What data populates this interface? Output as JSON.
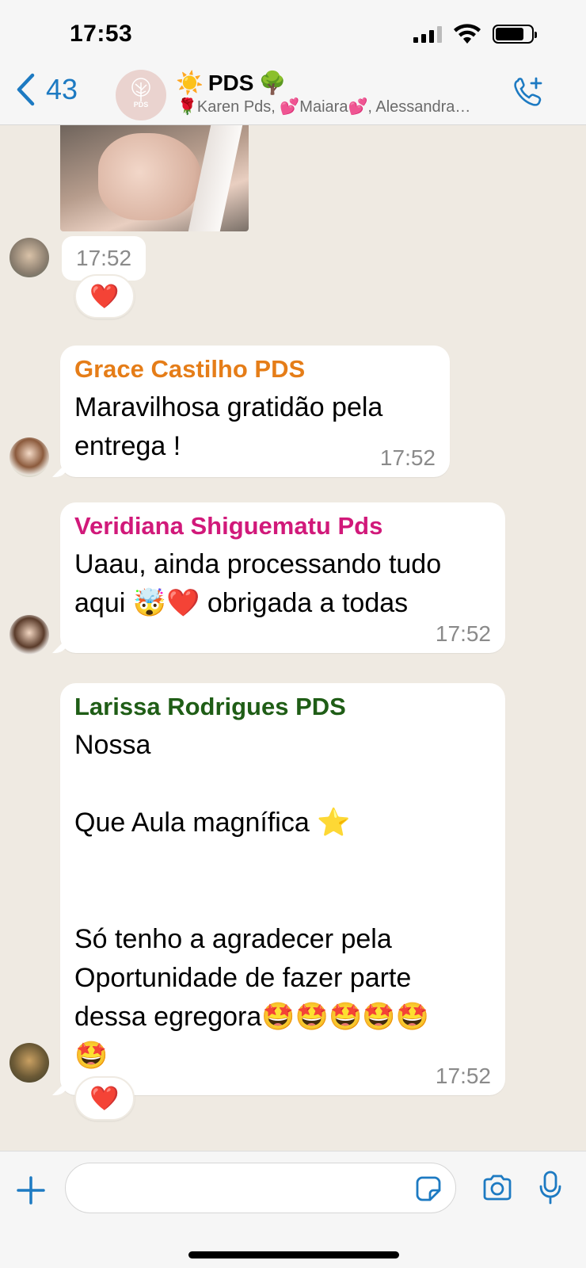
{
  "status_bar": {
    "time": "17:53"
  },
  "header": {
    "back_count": "43",
    "group_avatar_text": "PDS",
    "title_emoji_before": "☀️",
    "title": "PDS",
    "title_emoji_after": "🌳",
    "subtitle": "🌹Karen Pds, 💕Maiara💕, Alessandra…"
  },
  "messages": [
    {
      "type": "media",
      "time": "17:52",
      "reaction": "❤️"
    },
    {
      "sender": "Grace Castilho PDS",
      "sender_color": "#e57d18",
      "text": "Maravilhosa gratidão pela\nentrega !",
      "time": "17:52"
    },
    {
      "sender": "Veridiana Shiguematu Pds",
      "sender_color": "#d1197a",
      "text": "Uaau, ainda processando tudo\naqui 🤯❤️ obrigada a todas",
      "time": "17:52"
    },
    {
      "sender": "Larissa Rodrigues PDS",
      "sender_color": "#1f5d16",
      "text": "Nossa\n\nQue Aula magnífica ⭐\n\n\nSó tenho a agradecer pela\nOportunidade de fazer parte\ndessa egregora🤩🤩🤩🤩🤩\n🤩",
      "time": "17:52",
      "reaction": "❤️"
    }
  ],
  "input": {
    "value": "",
    "placeholder": ""
  },
  "colors": {
    "accent": "#1d7ac2",
    "chat_background": "#efeae2"
  }
}
